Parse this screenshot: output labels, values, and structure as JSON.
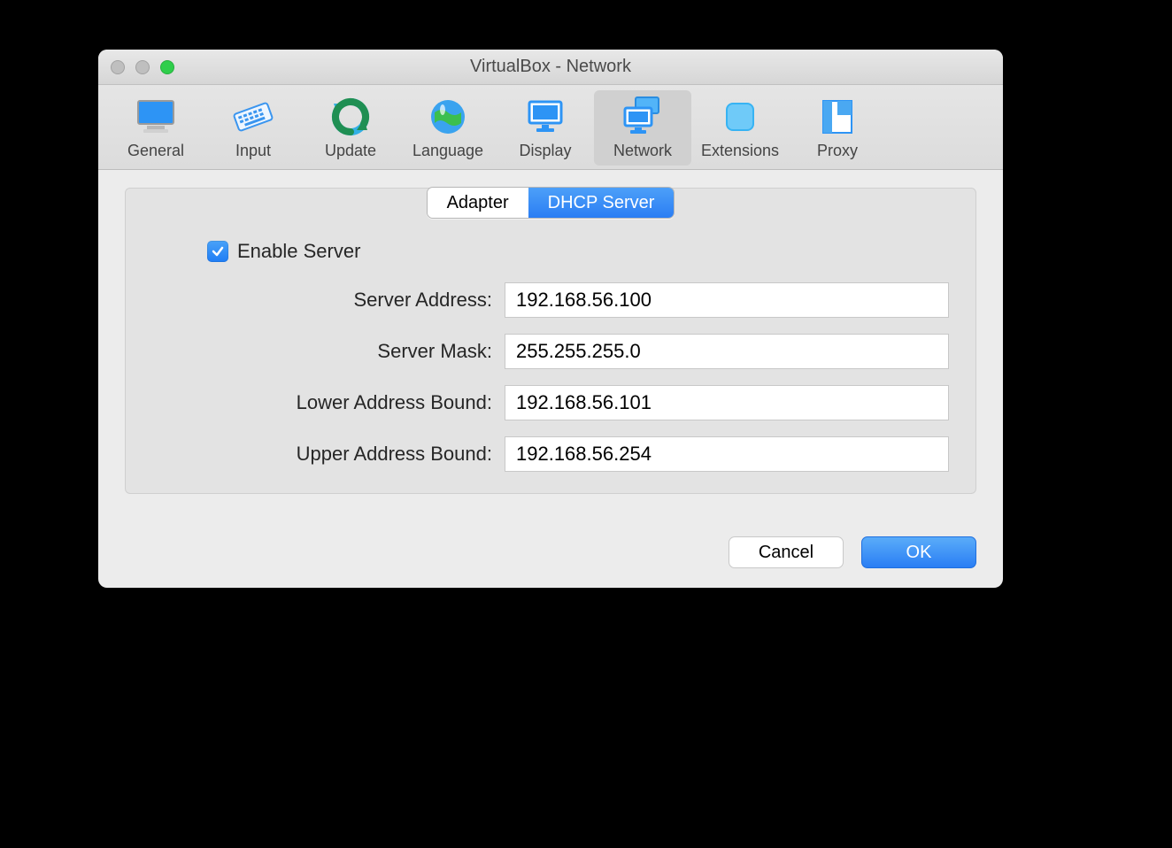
{
  "window": {
    "title": "VirtualBox - Network"
  },
  "toolbar": {
    "items": [
      {
        "label": "General"
      },
      {
        "label": "Input"
      },
      {
        "label": "Update"
      },
      {
        "label": "Language"
      },
      {
        "label": "Display"
      },
      {
        "label": "Network"
      },
      {
        "label": "Extensions"
      },
      {
        "label": "Proxy"
      }
    ],
    "active_index": 5
  },
  "segmented": {
    "options": [
      {
        "label": "Adapter"
      },
      {
        "label": "DHCP Server"
      }
    ],
    "active_index": 1
  },
  "form": {
    "enable_server": {
      "label": "Enable Server",
      "checked": true
    },
    "fields": {
      "server_address": {
        "label": "Server Address:",
        "value": "192.168.56.100"
      },
      "server_mask": {
        "label": "Server Mask:",
        "value": "255.255.255.0"
      },
      "lower_bound": {
        "label": "Lower Address Bound:",
        "value": "192.168.56.101"
      },
      "upper_bound": {
        "label": "Upper Address Bound:",
        "value": "192.168.56.254"
      }
    }
  },
  "buttons": {
    "cancel": "Cancel",
    "ok": "OK"
  },
  "colors": {
    "accent": "#2a7ef4"
  }
}
